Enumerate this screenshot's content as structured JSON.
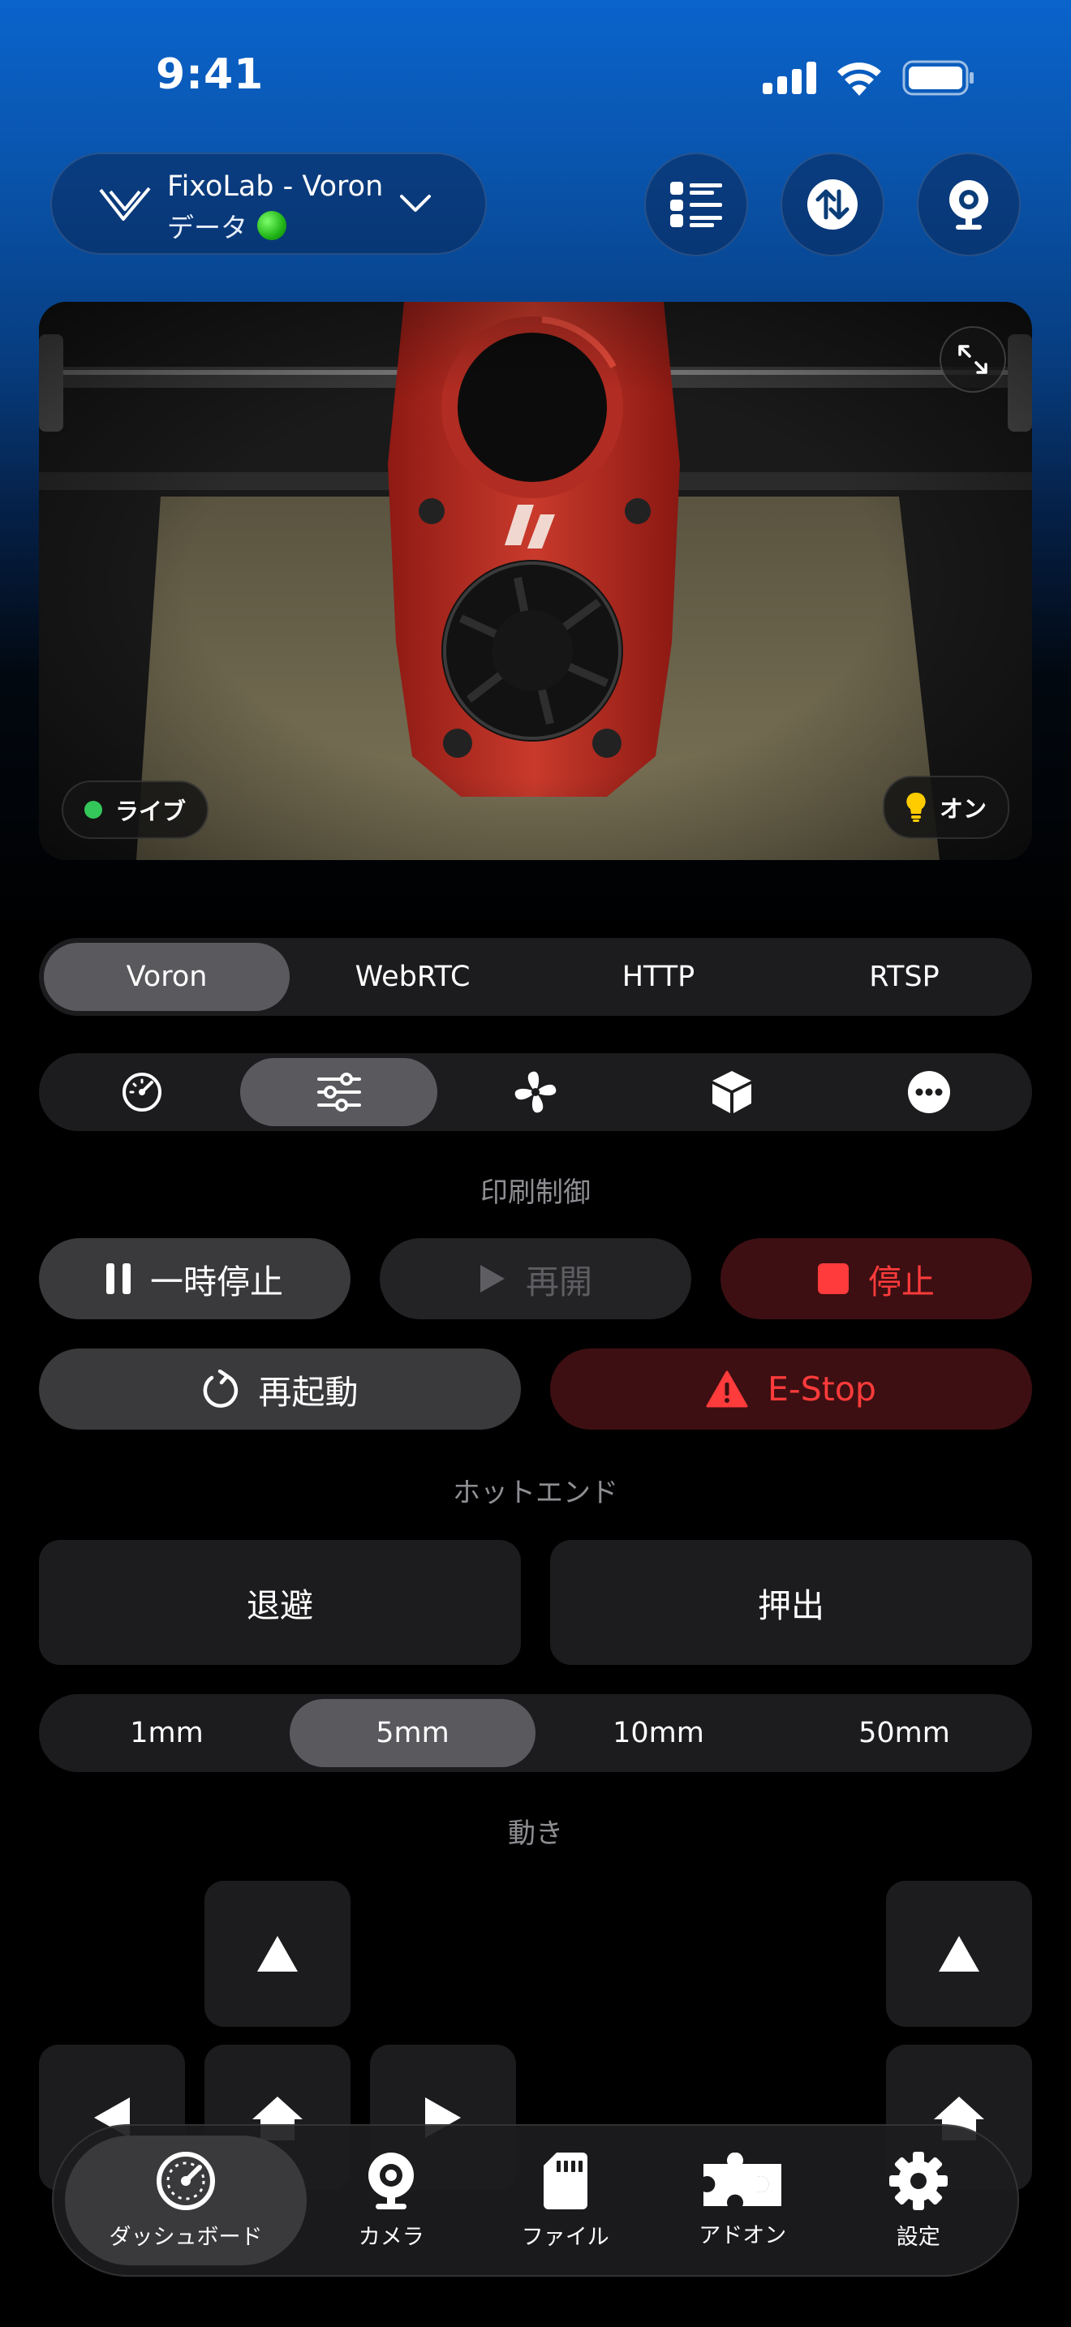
{
  "status_bar": {
    "time": "9:41"
  },
  "header": {
    "printer_name": "FixoLab - Voron",
    "printer_subtitle": "データ",
    "buttons": [
      {
        "icon": "list-icon"
      },
      {
        "icon": "transfer-icon"
      },
      {
        "icon": "webcam-icon"
      }
    ]
  },
  "camera": {
    "live_label": "ライブ",
    "light_label": "オン"
  },
  "stream_tabs": {
    "items": [
      "Voron",
      "WebRTC",
      "HTTP",
      "RTSP"
    ],
    "selected": "Voron"
  },
  "control_tabs": {
    "items": [
      "gauge-icon",
      "sliders-icon",
      "fan-icon",
      "box-icon",
      "more-icon"
    ],
    "selected": "sliders-icon"
  },
  "print_control": {
    "title": "印刷制御",
    "pause": "一時停止",
    "resume": "再開",
    "stop": "停止",
    "restart": "再起動",
    "estop": "E-Stop"
  },
  "hotend": {
    "title": "ホットエンド",
    "retract": "退避",
    "extrude": "押出",
    "distances": [
      "1mm",
      "5mm",
      "10mm",
      "50mm"
    ],
    "selected_distance": "5mm"
  },
  "motion": {
    "title": "動き"
  },
  "tab_bar": {
    "items": [
      {
        "label": "ダッシュボード",
        "icon": "dashboard-icon"
      },
      {
        "label": "カメラ",
        "icon": "camera-icon"
      },
      {
        "label": "ファイル",
        "icon": "sdcard-icon"
      },
      {
        "label": "アドオン",
        "icon": "puzzle-icon"
      },
      {
        "label": "設定",
        "icon": "gear-icon"
      }
    ],
    "selected": "ダッシュボード"
  },
  "colors": {
    "accent_red": "#ff3b3b",
    "live_green": "#34c759",
    "brand_blue": "#0a64cc"
  }
}
